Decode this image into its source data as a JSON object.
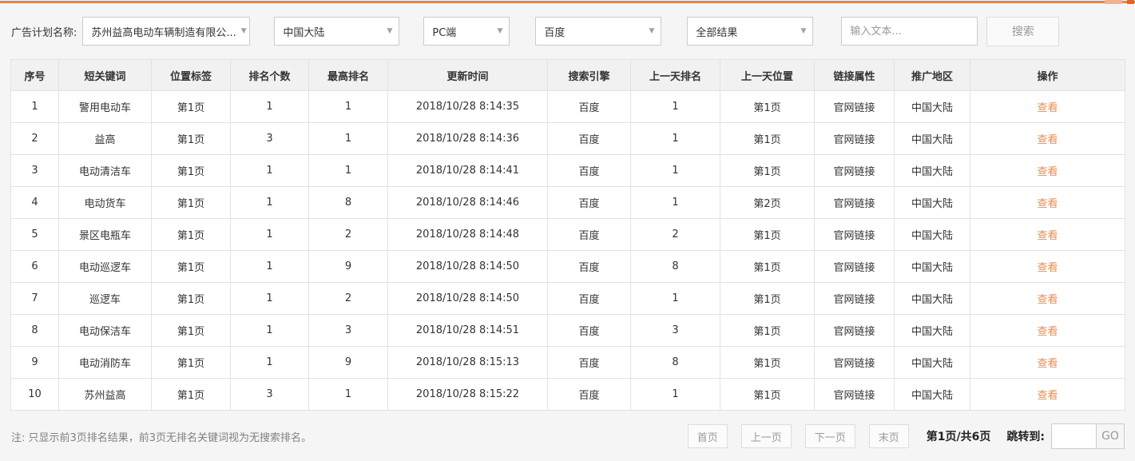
{
  "colors": {
    "top_accent": "#e0874e",
    "link_orange": "#ef8c4a"
  },
  "filter_bar": {
    "label": "广告计划名称:",
    "selects": [
      {
        "name": "campaign",
        "value": "苏州益高电动车辆制造有限公..."
      },
      {
        "name": "region",
        "value": "中国大陆"
      },
      {
        "name": "device",
        "value": "PC端"
      },
      {
        "name": "engine",
        "value": "百度"
      },
      {
        "name": "result-type",
        "value": "全部结果"
      }
    ],
    "search_input": {
      "placeholder": "输入文本...",
      "value": ""
    },
    "search_button": "搜索"
  },
  "table": {
    "headers": [
      "序号",
      "短关键词",
      "位置标签",
      "排名个数",
      "最高排名",
      "更新时间",
      "搜索引擎",
      "上一天排名",
      "上一天位置",
      "链接属性",
      "推广地区",
      "操作"
    ],
    "action_label": "查看",
    "rows": [
      [
        "1",
        "警用电动车",
        "第1页",
        "1",
        "1",
        "2018/10/28 8:14:35",
        "百度",
        "1",
        "第1页",
        "官网链接",
        "中国大陆"
      ],
      [
        "2",
        "益高",
        "第1页",
        "3",
        "1",
        "2018/10/28 8:14:36",
        "百度",
        "1",
        "第1页",
        "官网链接",
        "中国大陆"
      ],
      [
        "3",
        "电动清洁车",
        "第1页",
        "1",
        "1",
        "2018/10/28 8:14:41",
        "百度",
        "1",
        "第1页",
        "官网链接",
        "中国大陆"
      ],
      [
        "4",
        "电动货车",
        "第1页",
        "1",
        "8",
        "2018/10/28 8:14:46",
        "百度",
        "1",
        "第2页",
        "官网链接",
        "中国大陆"
      ],
      [
        "5",
        "景区电瓶车",
        "第1页",
        "1",
        "2",
        "2018/10/28 8:14:48",
        "百度",
        "2",
        "第1页",
        "官网链接",
        "中国大陆"
      ],
      [
        "6",
        "电动巡逻车",
        "第1页",
        "1",
        "9",
        "2018/10/28 8:14:50",
        "百度",
        "8",
        "第1页",
        "官网链接",
        "中国大陆"
      ],
      [
        "7",
        "巡逻车",
        "第1页",
        "1",
        "2",
        "2018/10/28 8:14:50",
        "百度",
        "1",
        "第1页",
        "官网链接",
        "中国大陆"
      ],
      [
        "8",
        "电动保洁车",
        "第1页",
        "1",
        "3",
        "2018/10/28 8:14:51",
        "百度",
        "3",
        "第1页",
        "官网链接",
        "中国大陆"
      ],
      [
        "9",
        "电动消防车",
        "第1页",
        "1",
        "9",
        "2018/10/28 8:15:13",
        "百度",
        "8",
        "第1页",
        "官网链接",
        "中国大陆"
      ],
      [
        "10",
        "苏州益高",
        "第1页",
        "3",
        "1",
        "2018/10/28 8:15:22",
        "百度",
        "1",
        "第1页",
        "官网链接",
        "中国大陆"
      ]
    ]
  },
  "footer": {
    "note": "注: 只显示前3页排名结果，前3页无排名关键词视为无搜索排名。",
    "pagination": {
      "first": "首页",
      "prev": "上一页",
      "next": "下一页",
      "last": "末页",
      "page_info": "第1页/共6页",
      "jump_label": "跳转到:",
      "jump_value": "",
      "go": "GO"
    }
  }
}
